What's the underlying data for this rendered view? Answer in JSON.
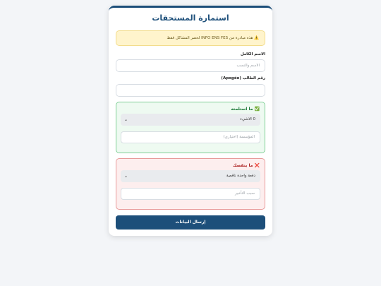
{
  "form": {
    "title": "استمارة المستحقات",
    "notice": "⚠️ هذه مبادرة من INFO ENS FES لحصر المشاكل فقط",
    "full_name_label": "الاسم الكامل",
    "full_name_placeholder": "الاسم والنسب",
    "apogee_label": "رقم الطالب (Apogée)",
    "apogee_value": "",
    "received": {
      "title": "✅ ما استلمته",
      "selected": "0 الاشيء",
      "institution_placeholder": "المؤسسة (اختياري)"
    },
    "missing": {
      "title": "❌ ما ينقصك",
      "selected": "دفعة واحدة ناقصة",
      "reason_placeholder": "سبب التأخير"
    },
    "submit_label": "إرسال البيانات"
  },
  "colors": {
    "primary": "#1d4f7a",
    "success_bg": "#eefaf1",
    "success_border": "#7fcf96",
    "danger_bg": "#fdeeee",
    "danger_border": "#e89a9a",
    "warning_bg": "#fff4cc"
  }
}
